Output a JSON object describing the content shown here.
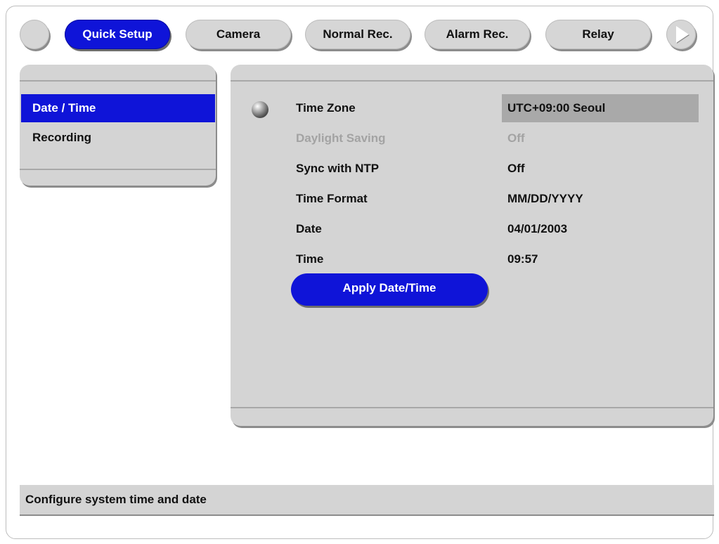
{
  "tabs": [
    {
      "label": "Quick Setup",
      "active": true
    },
    {
      "label": "Camera",
      "active": false
    },
    {
      "label": "Normal Rec.",
      "active": false
    },
    {
      "label": "Alarm Rec.",
      "active": false
    },
    {
      "label": "Relay",
      "active": false
    }
  ],
  "icons": {
    "prev": "circle-button-icon",
    "next": "play-arrow-icon",
    "bullet": "sphere-bullet-icon"
  },
  "sidebar": {
    "items": [
      {
        "label": "Date / Time",
        "active": true
      },
      {
        "label": "Recording",
        "active": false
      }
    ]
  },
  "settings": [
    {
      "label": "Time Zone",
      "value": "UTC+09:00 Seoul",
      "enabled": true,
      "selected": true
    },
    {
      "label": "Daylight Saving",
      "value": "Off",
      "enabled": false
    },
    {
      "label": "Sync with NTP",
      "value": "Off",
      "enabled": true
    },
    {
      "label": "Time Format",
      "value": "MM/DD/YYYY",
      "enabled": true
    },
    {
      "label": "Date",
      "value": "04/01/2003",
      "enabled": true
    },
    {
      "label": "Time",
      "value": "09:57",
      "enabled": true
    }
  ],
  "apply_button": "Apply Date/Time",
  "status": "Configure system time and date",
  "colors": {
    "accent": "#0f14d8",
    "panel": "#d4d4d4",
    "selected_value": "#a9a9a9",
    "disabled_text": "#a3a3a3"
  }
}
